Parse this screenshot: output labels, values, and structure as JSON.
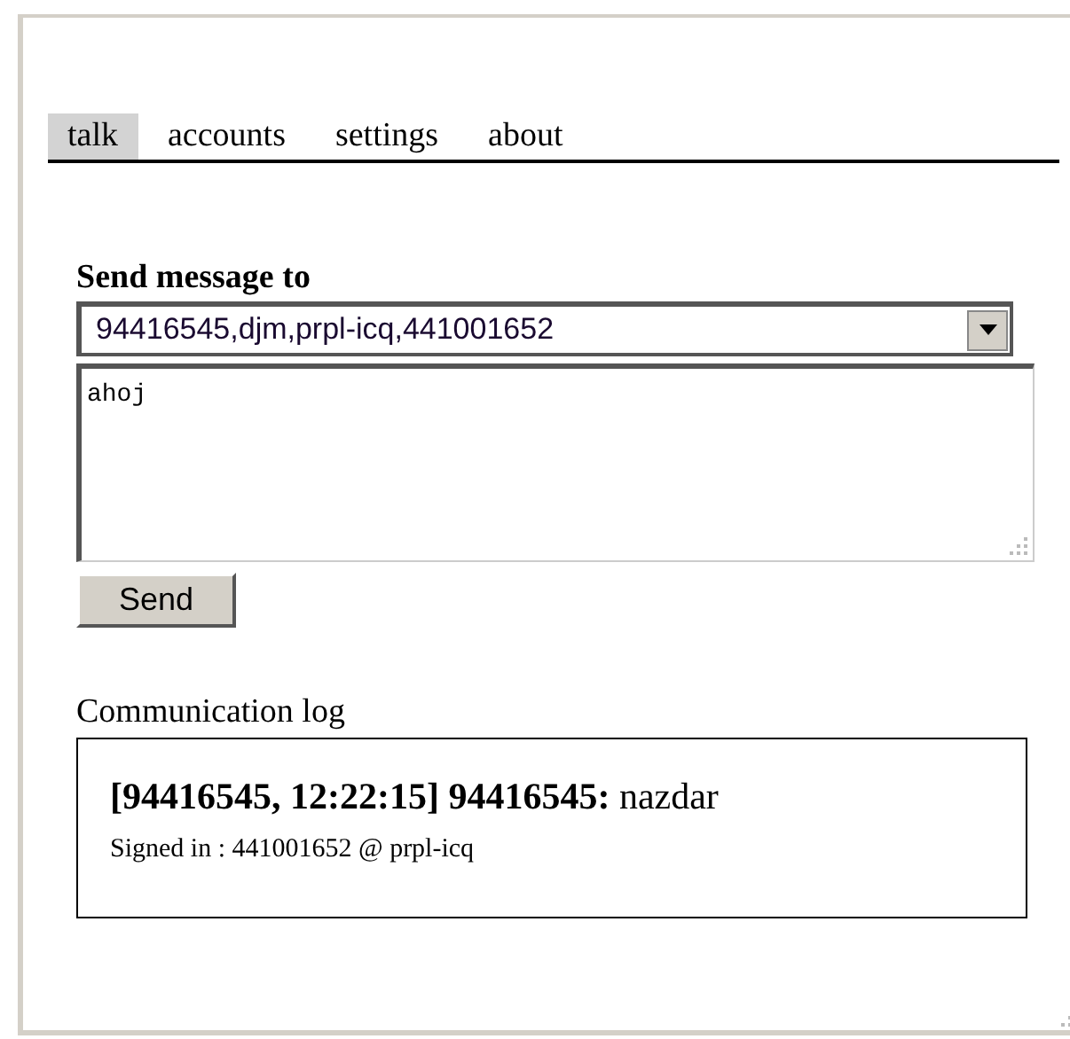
{
  "tabs": [
    {
      "label": "talk",
      "selected": true
    },
    {
      "label": "accounts",
      "selected": false
    },
    {
      "label": "settings",
      "selected": false
    },
    {
      "label": "about",
      "selected": false
    }
  ],
  "send_form": {
    "heading": "Send message to",
    "recipient": "94416545,djm,prpl-icq,441001652",
    "message": "ahoj",
    "button": "Send"
  },
  "log": {
    "heading": "Communication log",
    "entries": [
      {
        "kind": "message",
        "text": "**[94416545, 12:22:15] 94416545:** nazdar"
      },
      {
        "kind": "status",
        "text": "Signed in : 441001652 @ prpl-icq"
      }
    ]
  }
}
